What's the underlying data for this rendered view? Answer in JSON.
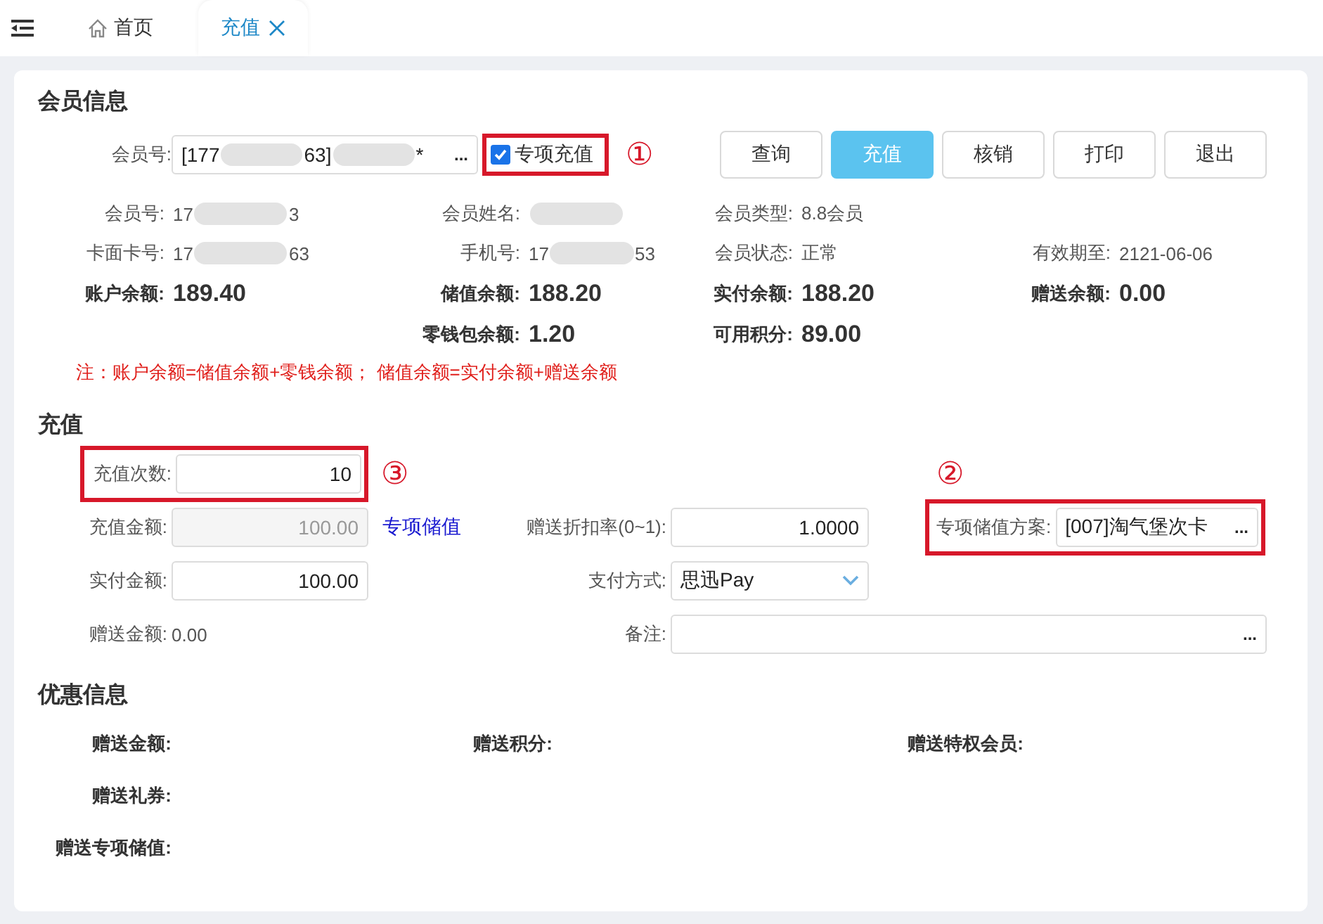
{
  "tabs": [
    {
      "label": "首页",
      "kind": "home",
      "selected": false,
      "closable": false
    },
    {
      "label": "充值",
      "selected": true,
      "closable": true
    }
  ],
  "member_section": {
    "title": "会员信息",
    "member_field": {
      "label": "会员号:",
      "value_parts": [
        "[177",
        "63]",
        "*"
      ],
      "picker_mark": "..."
    },
    "special_checkbox": {
      "label": "专项充值",
      "checked": true,
      "annotation": "①"
    },
    "buttons": [
      {
        "label": "查询",
        "primary": false
      },
      {
        "label": "充值",
        "primary": true
      },
      {
        "label": "核销",
        "primary": false
      },
      {
        "label": "打印",
        "primary": false
      },
      {
        "label": "退出",
        "primary": false
      }
    ],
    "info_rows": [
      {
        "kind": "plain",
        "cells": [
          {
            "label": "会员号:",
            "value_parts": [
              "17",
              "3"
            ]
          },
          {
            "label": "会员姓名:",
            "blurred": true
          },
          {
            "label": "会员类型:",
            "value": "8.8会员"
          },
          null
        ]
      },
      {
        "kind": "plain",
        "cells": [
          {
            "label": "卡面卡号:",
            "value_parts": [
              "17",
              "63"
            ]
          },
          {
            "label": "手机号:",
            "value_parts": [
              "17",
              "53"
            ]
          },
          {
            "label": "会员状态:",
            "value": "正常"
          },
          {
            "label": "有效期至:",
            "value": "2121-06-06"
          }
        ]
      },
      {
        "kind": "amount",
        "cells": [
          {
            "label": "账户余额:",
            "value": "189.40"
          },
          {
            "label": "储值余额:",
            "value": "188.20"
          },
          {
            "label": "实付余额:",
            "value": "188.20"
          },
          {
            "label": "赠送余额:",
            "value": "0.00"
          }
        ]
      },
      {
        "kind": "amount",
        "cells": [
          null,
          {
            "label": "零钱包余额:",
            "value": "1.20"
          },
          {
            "label": "可用积分:",
            "value": "89.00"
          },
          null
        ]
      }
    ],
    "note": "注：账户余额=储值余额+零钱余额；  储值余额=实付余额+赠送余额"
  },
  "charge_section": {
    "title": "充值",
    "rows": [
      [
        {
          "kind": "input",
          "label": "充值次数:",
          "value": "10",
          "annotation": "③"
        },
        null,
        null,
        {
          "kind": "marker",
          "annotation": "②"
        }
      ],
      [
        {
          "kind": "input",
          "label": "充值金额:",
          "value": "100.00",
          "disabled": true
        },
        {
          "kind": "link",
          "label": "专项储值"
        },
        {
          "kind": "input",
          "label": "赠送折扣率(0~1):",
          "value": "1.0000"
        },
        {
          "kind": "picker",
          "label": "专项储值方案:",
          "value": "[007]淘气堡次卡",
          "picker_mark": "...",
          "highlighted": true
        }
      ],
      [
        {
          "kind": "input",
          "label": "实付金额:",
          "value": "100.00"
        },
        null,
        {
          "kind": "select",
          "label": "支付方式:",
          "value": "思迅Pay"
        },
        null
      ],
      [
        {
          "kind": "text",
          "label": "赠送金额:",
          "value": "0.00"
        },
        null,
        {
          "kind": "picker",
          "label": "备注:",
          "picker_mark": "...",
          "wide": true
        },
        null
      ]
    ]
  },
  "promo_section": {
    "title": "优惠信息",
    "rows": [
      [
        "赠送金额:",
        "赠送积分:",
        "赠送特权会员:"
      ],
      [
        "赠送礼券:"
      ],
      [
        "赠送专项储值:"
      ]
    ]
  }
}
